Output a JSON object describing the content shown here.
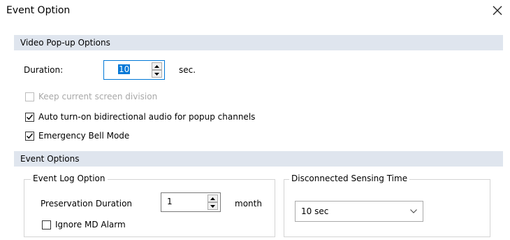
{
  "window": {
    "title": "Event Option",
    "close_icon": "close-icon"
  },
  "video_popup": {
    "header": "Video Pop-up Options",
    "duration_label": "Duration:",
    "duration_value": "10",
    "duration_unit": "sec.",
    "keep_division_label": "Keep current screen division",
    "keep_division_checked": false,
    "keep_division_enabled": false,
    "auto_audio_label": "Auto turn-on bidirectional audio for popup channels",
    "auto_audio_checked": true,
    "emergency_bell_label": "Emergency Bell Mode",
    "emergency_bell_checked": true
  },
  "event_options": {
    "header": "Event Options",
    "event_log": {
      "legend": "Event Log Option",
      "preservation_label": "Preservation Duration",
      "preservation_value": "1",
      "preservation_unit": "month",
      "ignore_md_label": "Ignore MD Alarm",
      "ignore_md_checked": false
    },
    "disconnected": {
      "legend": "Disconnected Sensing Time",
      "selected": "10 sec"
    }
  },
  "colors": {
    "section_bar": "#dfe5ee",
    "selection": "#0078d7"
  }
}
